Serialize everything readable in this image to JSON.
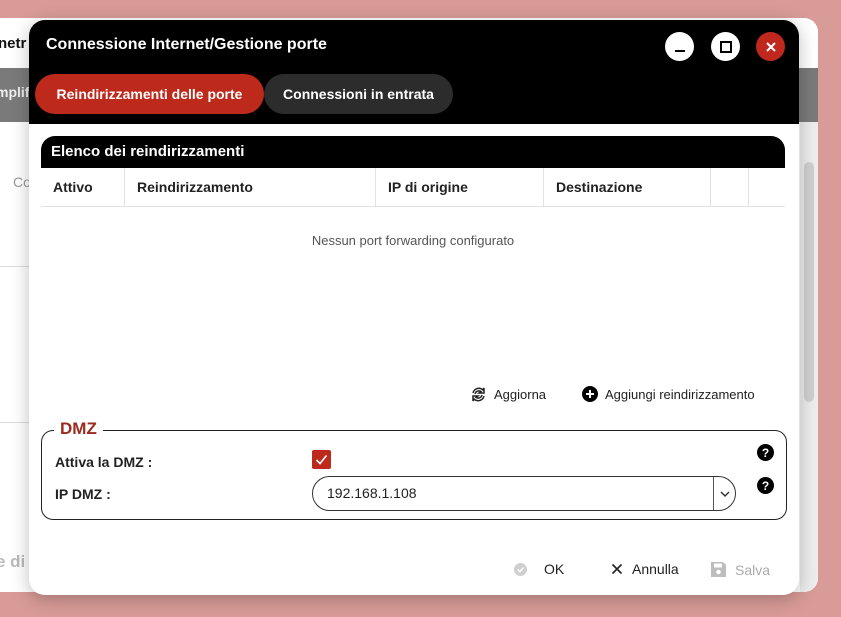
{
  "background": {
    "title_fragment": "netr",
    "tab_fragment": "mplif",
    "side_text": "Co",
    "bottom_text": "e di t"
  },
  "dialog": {
    "title": "Connessione Internet/Gestione porte",
    "tabs": [
      {
        "label": "Reindirizzamenti delle porte",
        "active": true
      },
      {
        "label": "Connessioni in entrata",
        "active": false
      }
    ],
    "list": {
      "title": "Elenco dei reindirizzamenti",
      "columns": [
        "Attivo",
        "Reindirizzamento",
        "IP di origine",
        "Destinazione",
        "",
        ""
      ],
      "empty_message": "Nessun port forwarding configurato"
    },
    "actions": {
      "refresh": "Aggiorna",
      "add": "Aggiungi reindirizzamento"
    },
    "dmz": {
      "legend": "DMZ",
      "enable_label": "Attiva la DMZ :",
      "enabled": true,
      "ip_label": "IP DMZ :",
      "ip_value": "192.168.1.108",
      "help_symbol": "?"
    },
    "footer": {
      "ok": "OK",
      "cancel": "Annulla",
      "save": "Salva"
    }
  },
  "colors": {
    "accent": "#bd2a1c",
    "header_bg": "#000000",
    "page_bg": "#d89b97",
    "disabled_text": "#aaaaaa"
  }
}
